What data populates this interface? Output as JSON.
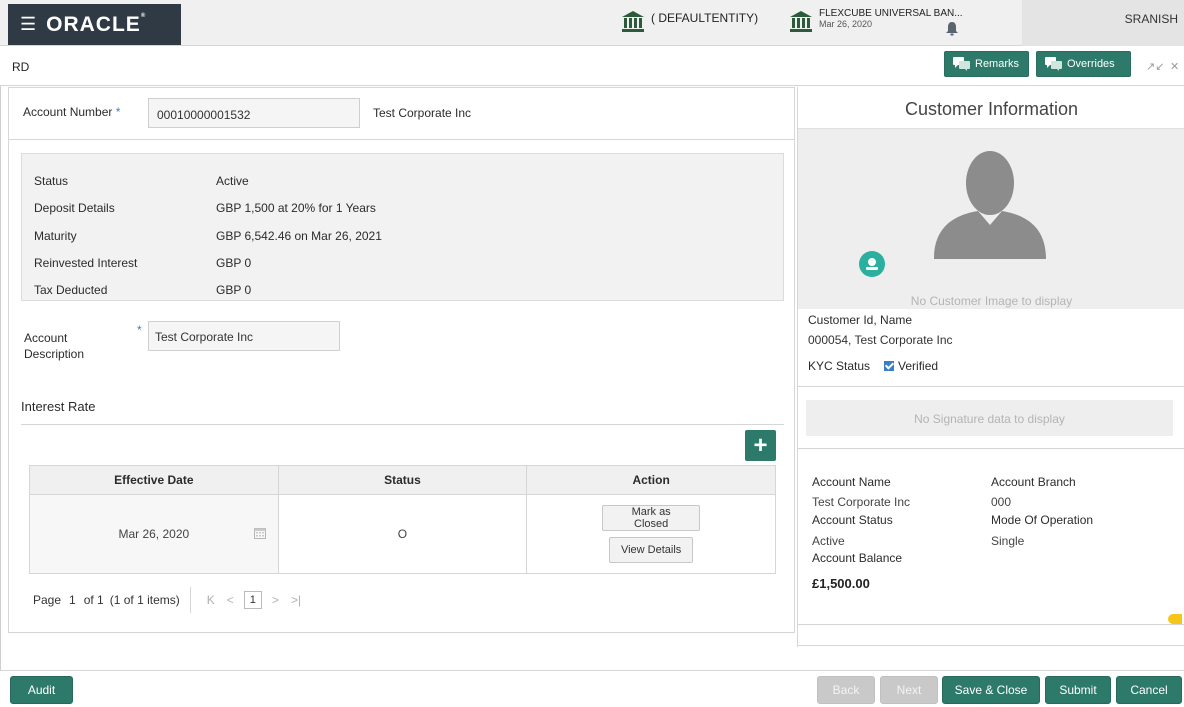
{
  "topbar": {
    "brand": "ORACLE",
    "entity": "( DEFAULTENTITY)",
    "branch_name": "FLEXCUBE UNIVERSAL BAN...",
    "branch_date": "Mar 26, 2020",
    "user": "SRANISH"
  },
  "header": {
    "title": "RD",
    "remarks_label": "Remarks",
    "overrides_label": "Overrides"
  },
  "account": {
    "number_label": "Account Number",
    "number_value": "00010000001532",
    "name": "Test Corporate Inc"
  },
  "details": [
    {
      "label": "Status",
      "value": "Active"
    },
    {
      "label": "Deposit Details",
      "value": "GBP 1,500 at 20% for 1 Years"
    },
    {
      "label": "Maturity",
      "value": "GBP 6,542.46 on Mar 26, 2021"
    },
    {
      "label": "Reinvested Interest",
      "value": "GBP 0"
    },
    {
      "label": "Tax Deducted",
      "value": "GBP 0"
    }
  ],
  "description": {
    "label_line1": "Account",
    "label_line2": "Description",
    "value": "Test Corporate Inc"
  },
  "interest": {
    "section_title": "Interest Rate",
    "columns": [
      "Effective Date",
      "Status",
      "Action"
    ],
    "rows": [
      {
        "effective_date": "Mar 26, 2020",
        "status": "O",
        "action_primary": "Mark as Closed",
        "action_secondary": "View Details"
      }
    ],
    "pager": {
      "page_label": "Page",
      "page_number": "1",
      "of_text": "of 1",
      "items_text": "(1 of 1 items)",
      "current": "1"
    }
  },
  "customer": {
    "title": "Customer Information",
    "no_image": "No Customer Image to display",
    "id_label": "Customer Id, Name",
    "id_value": "000054, Test Corporate Inc",
    "kyc_label": "KYC Status",
    "kyc_value": "Verified",
    "no_signature": "No Signature data to display",
    "account_name_label": "Account Name",
    "account_name_value": "Test Corporate Inc",
    "account_branch_label": "Account Branch",
    "account_branch_value": "000",
    "account_status_label": "Account Status",
    "account_status_value": "Active",
    "mode_label": "Mode Of Operation",
    "mode_value": "Single",
    "balance_label": "Account Balance",
    "balance_value": "£1,500.00"
  },
  "footer": {
    "audit": "Audit",
    "back": "Back",
    "next": "Next",
    "save_close": "Save & Close",
    "submit": "Submit",
    "cancel": "Cancel"
  },
  "colors": {
    "accent": "#2d7a6a",
    "brand_bar": "#2f3a45",
    "verified": "#3a7fc4",
    "toggle": "#f5c518"
  }
}
